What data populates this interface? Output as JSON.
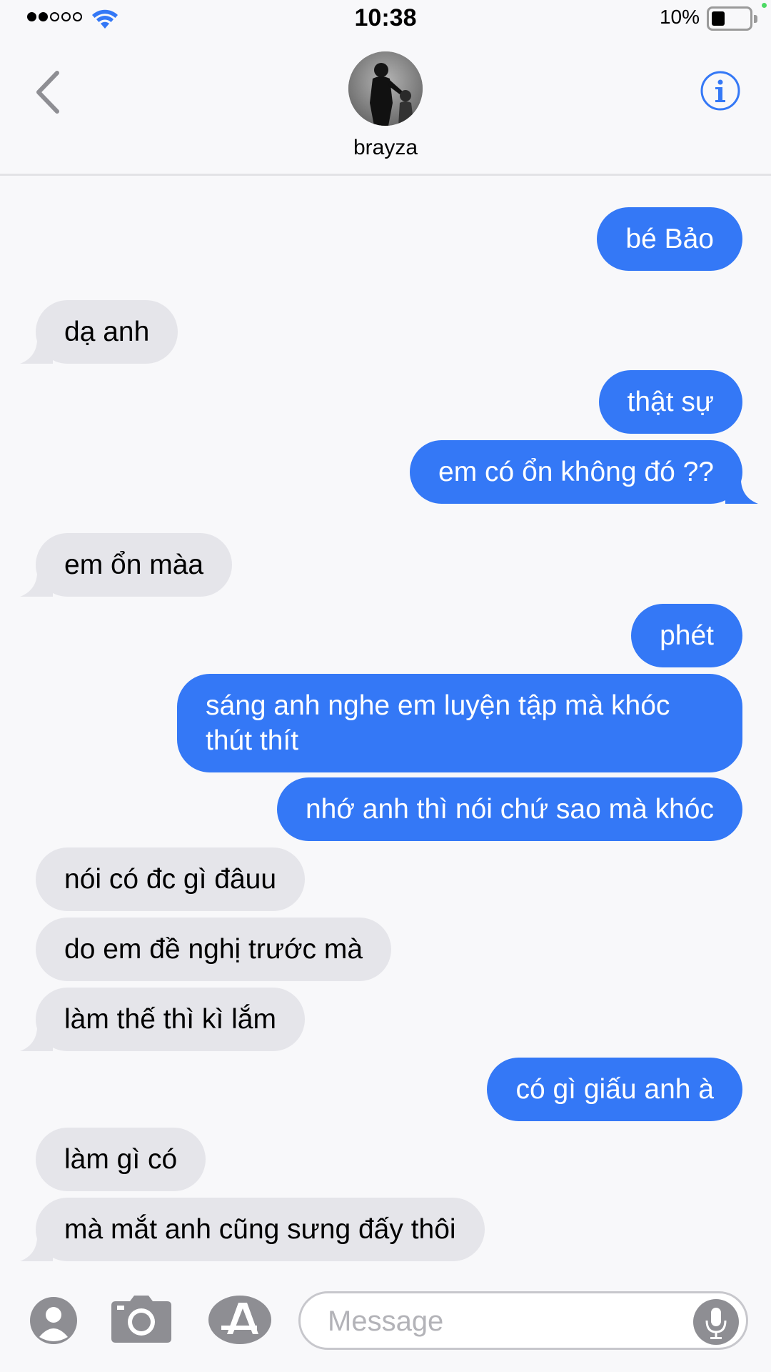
{
  "status_bar": {
    "time": "10:38",
    "battery_percent": "10%",
    "signal_bars_filled": 2,
    "signal_bars_total": 5,
    "battery_level": 0.1
  },
  "header": {
    "contact_name": "brayza",
    "back_icon": "chevron-left-icon",
    "info_icon": "info-icon"
  },
  "messages": [
    {
      "dir": "out",
      "text": "bé Bảo"
    },
    {
      "dir": "in",
      "text": "dạ anh"
    },
    {
      "dir": "out",
      "text": "thật sự"
    },
    {
      "dir": "out",
      "text": "em có ổn không đó ??"
    },
    {
      "dir": "in",
      "text": "em ổn màa"
    },
    {
      "dir": "out",
      "text": "phét"
    },
    {
      "dir": "out",
      "text": "sáng anh nghe em luyện tập mà khóc thút thít"
    },
    {
      "dir": "out",
      "text": "nhớ anh thì nói chứ sao mà khóc"
    },
    {
      "dir": "in",
      "text": "nói có đc gì đâuu"
    },
    {
      "dir": "in",
      "text": "do em đề nghị trước mà"
    },
    {
      "dir": "in",
      "text": "làm thế thì kì lắm"
    },
    {
      "dir": "out",
      "text": "có gì giấu anh à"
    },
    {
      "dir": "in",
      "text": "làm gì có"
    },
    {
      "dir": "in",
      "text": "mà mắt anh cũng sưng đấy thôi"
    }
  ],
  "input_bar": {
    "placeholder": "Message",
    "value": ""
  },
  "colors": {
    "outgoing_bubble": "#3478f6",
    "incoming_bubble": "#e5e5ea",
    "accent": "#3478f6"
  }
}
